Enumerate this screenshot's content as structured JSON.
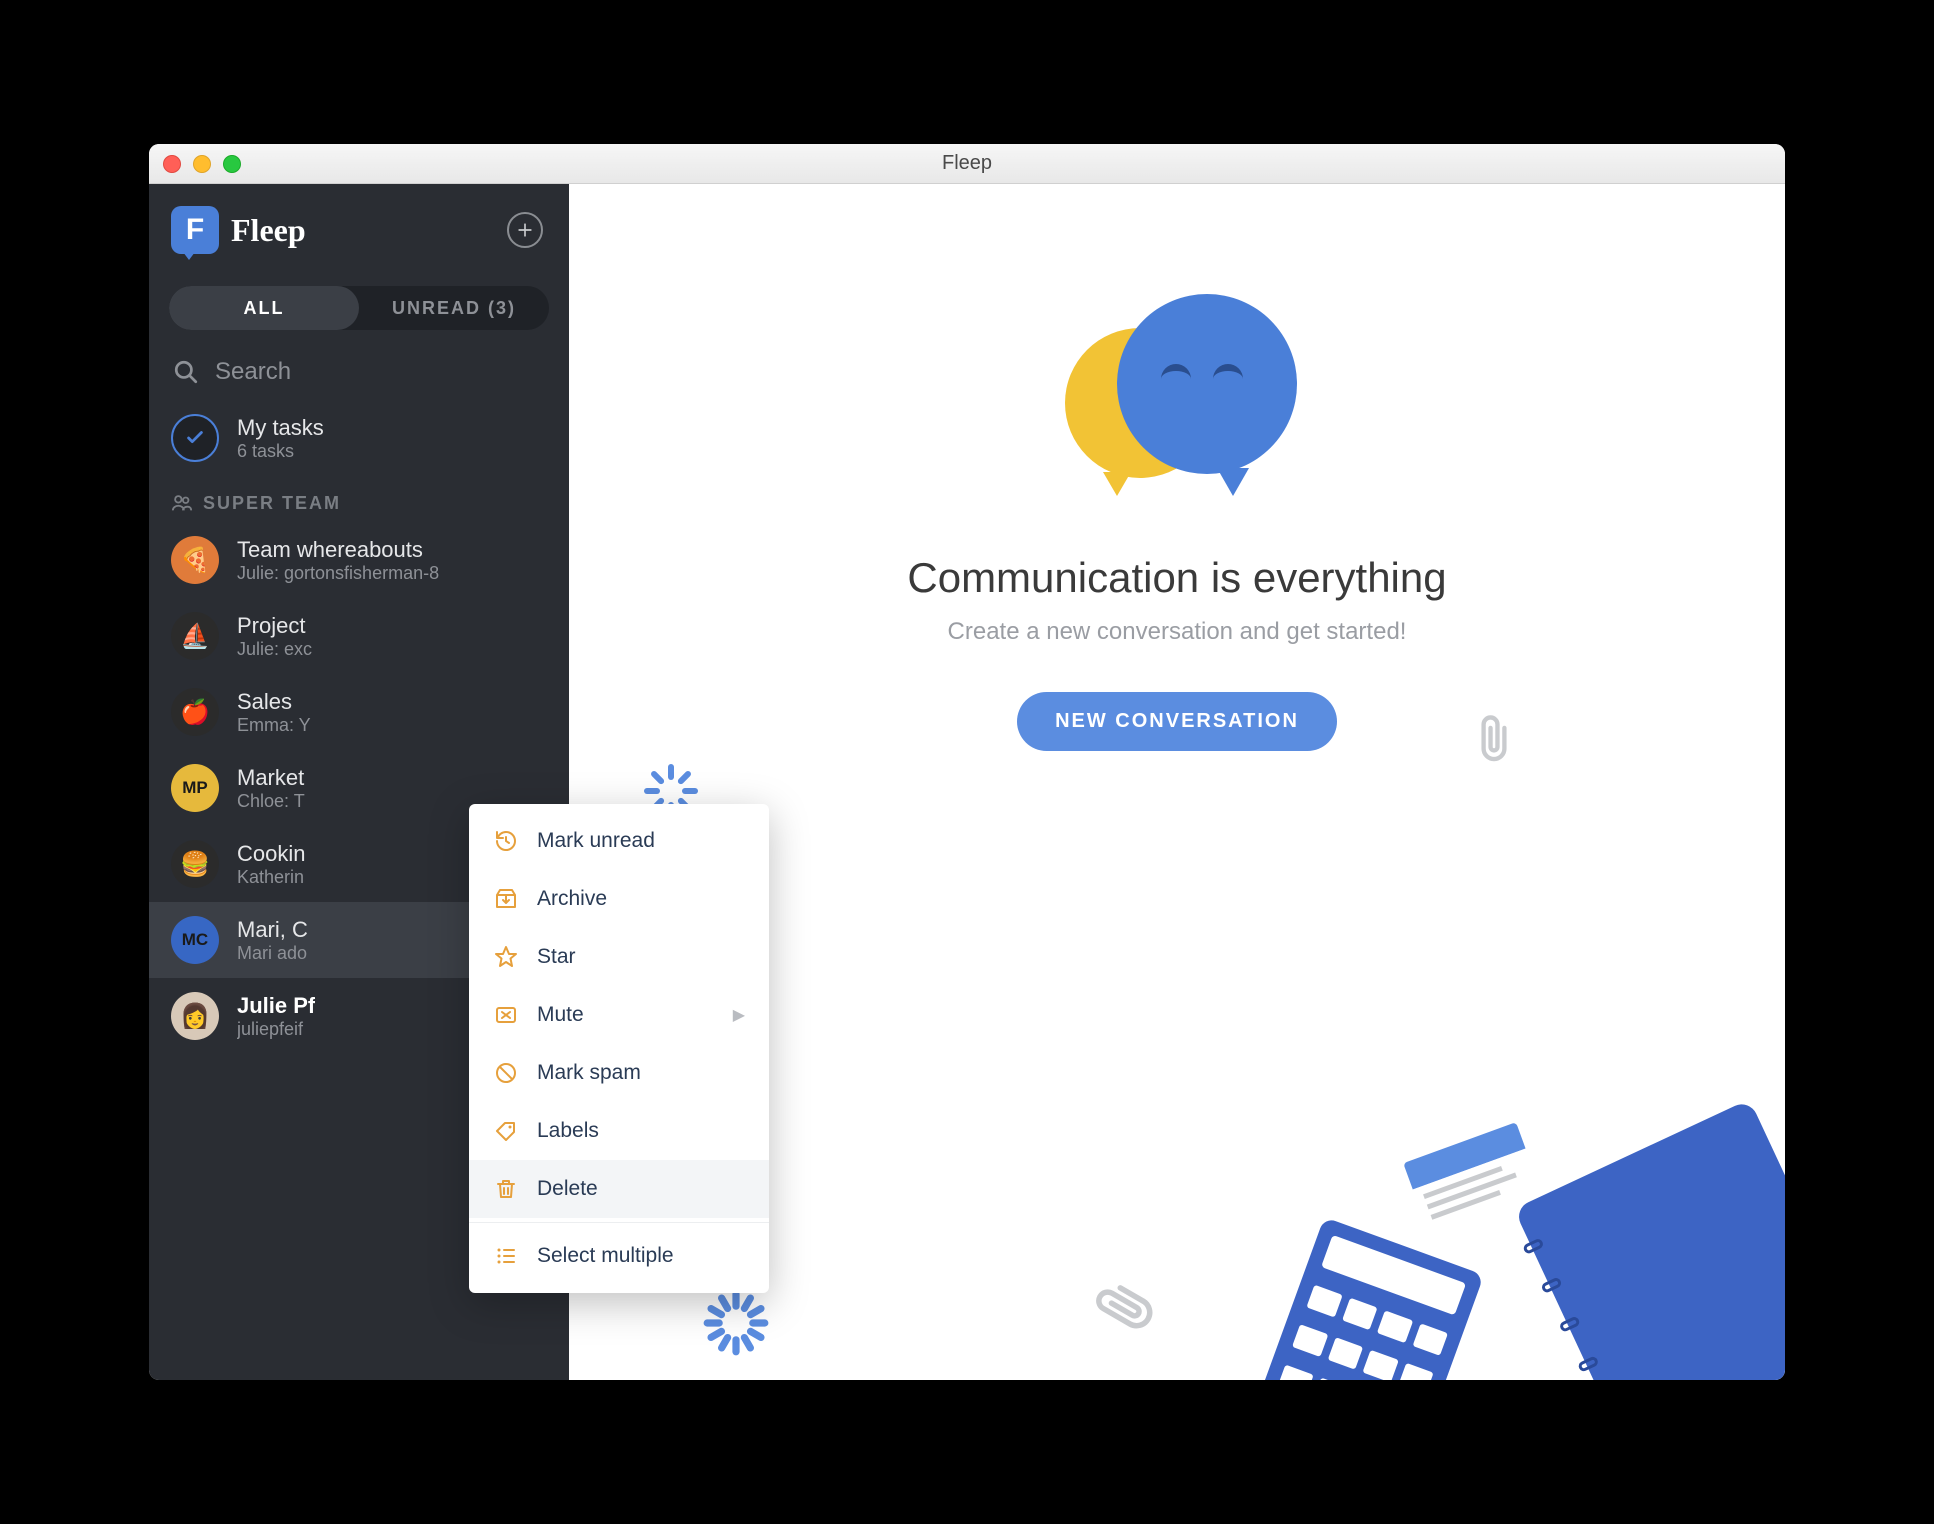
{
  "window": {
    "title": "Fleep"
  },
  "sidebar": {
    "app_name": "Fleep",
    "tabs": {
      "all": "ALL",
      "unread": "UNREAD (3)"
    },
    "search_placeholder": "Search",
    "my_tasks": {
      "title": "My tasks",
      "subtitle": "6 tasks"
    },
    "section_label": "SUPER TEAM",
    "conversations": [
      {
        "title": "Team whereabouts",
        "subtitle": "Julie: gortonsfisherman-8",
        "avatar_bg": "#e07b3a",
        "avatar_text": "🍕"
      },
      {
        "title": "Project",
        "subtitle": "Julie: exc",
        "avatar_bg": "#2b2b2b",
        "avatar_text": "⛵"
      },
      {
        "title": "Sales",
        "subtitle": "Emma: Y",
        "avatar_bg": "#2b2b2b",
        "avatar_text": "🍎"
      },
      {
        "title": "Market",
        "subtitle": "Chloe: T",
        "avatar_bg": "#e6b93c",
        "avatar_text": "MP"
      },
      {
        "title": "Cookin",
        "subtitle": "Katherin",
        "avatar_bg": "#2b2b2b",
        "avatar_text": "🍔"
      },
      {
        "title": "Mari, C",
        "subtitle": "Mari ado",
        "avatar_bg": "#3767c4",
        "avatar_text": "MC"
      },
      {
        "title": "Julie Pf",
        "subtitle": "juliepfeif",
        "avatar_bg": "#d8c9b8",
        "avatar_text": "👩"
      }
    ]
  },
  "context_menu": {
    "items": [
      {
        "label": "Mark unread",
        "icon": "history"
      },
      {
        "label": "Archive",
        "icon": "archive"
      },
      {
        "label": "Star",
        "icon": "star"
      },
      {
        "label": "Mute",
        "icon": "mute",
        "chevron": true
      },
      {
        "label": "Mark spam",
        "icon": "spam"
      },
      {
        "label": "Labels",
        "icon": "label"
      },
      {
        "label": "Delete",
        "icon": "trash"
      },
      {
        "label": "Select multiple",
        "icon": "list"
      }
    ]
  },
  "main": {
    "title": "Communication is everything",
    "subtitle": "Create a new conversation and get started!",
    "cta": "NEW CONVERSATION"
  }
}
